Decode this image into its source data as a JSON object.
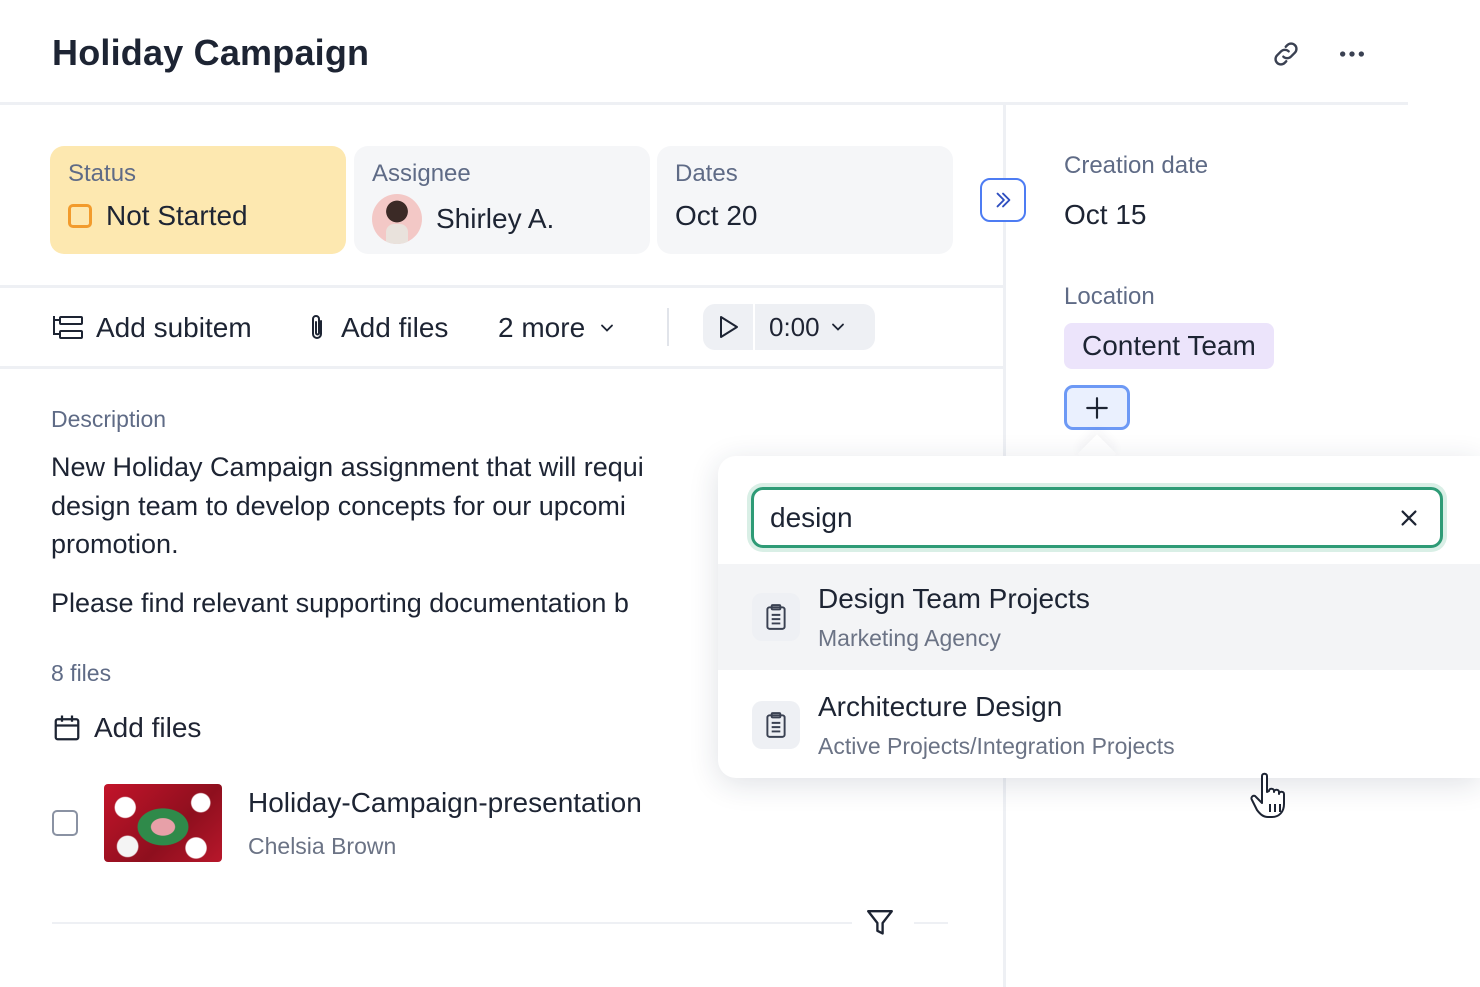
{
  "header": {
    "title": "Holiday Campaign",
    "icons": [
      "link-icon",
      "more-horizontal-icon"
    ]
  },
  "cards": {
    "status": {
      "label": "Status",
      "value": "Not Started",
      "color": "#fde8b0"
    },
    "assignee": {
      "label": "Assignee",
      "value": "Shirley A."
    },
    "dates": {
      "label": "Dates",
      "value": "Oct 20"
    }
  },
  "toolbar": {
    "add_subitem": "Add subitem",
    "add_files": "Add files",
    "more": "2 more",
    "timer": "0:00"
  },
  "sidebar": {
    "creation_label": "Creation date",
    "creation_value": "Oct 15",
    "location_label": "Location",
    "location_chip": "Content Team"
  },
  "description": {
    "label": "Description",
    "line1": "New Holiday Campaign assignment that will requi",
    "line2": "design team to develop concepts for our upcomi",
    "line3": "promotion.",
    "line4": "Please find relevant supporting documentation b"
  },
  "files": {
    "count": "8 files",
    "add_label": "Add files",
    "items": [
      {
        "name": "Holiday-Campaign-presentation",
        "author": "Chelsia Brown"
      }
    ]
  },
  "popup": {
    "search_value": "design",
    "options": [
      {
        "title": "Design Team Projects",
        "subtitle": "Marketing Agency"
      },
      {
        "title": "Architecture Design",
        "subtitle": "Active Projects/Integration Projects"
      }
    ]
  },
  "colors": {
    "accent": "#4d7cf3",
    "search_border": "#2e9b76",
    "status_bg": "#fde8b0",
    "location_chip_bg": "#ece4fb"
  }
}
